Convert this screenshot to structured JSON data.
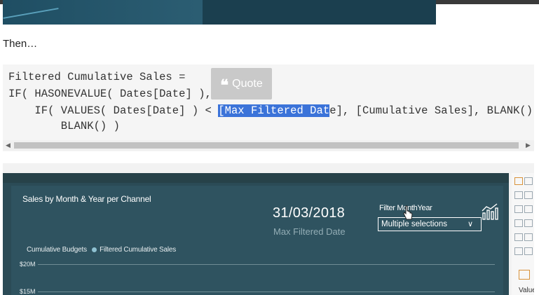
{
  "article": {
    "then_text": "Then…"
  },
  "code": {
    "line1": "Filtered Cumulative Sales =",
    "line2": "IF( HASONEVALUE( Dates[Date] ),",
    "line3_before": "    IF( VALUES( Dates[Date] ) < ",
    "line3_highlight": "[Max Filtered Dat",
    "line3_after": "e], [Cumulative Sales], BLANK() ),",
    "line4": "        BLANK() )",
    "quote_label": "Quote",
    "quote_icon": "quote-marks-icon"
  },
  "report": {
    "chart_title": "Sales by Month & Year per Channel",
    "card_value": "31/03/2018",
    "card_label": "Max Filtered Date",
    "slicer_title": "Filter MonthYear",
    "slicer_value": "Multiple selections",
    "legend_item1": "Cumulative Budgets",
    "legend_item2": "Filtered Cumulative Sales",
    "ytick_top": "$20M",
    "ytick_bottom": "$15M",
    "pane_label": "Value"
  },
  "colors": {
    "selection": "#3b73d9",
    "report_bg": "#2b4b56",
    "quote_button": "#c9c9c9"
  }
}
